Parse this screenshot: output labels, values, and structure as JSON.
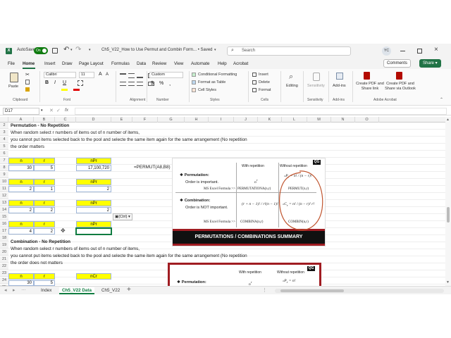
{
  "titlebar": {
    "autosave_label": "AutoSave",
    "autosave_state": "On",
    "file_name": "Ch5_V22_How to Use Permut and Combin Form... • Saved",
    "search_placeholder": "Search",
    "user_initials": "YC"
  },
  "menu": {
    "tabs": [
      "File",
      "Home",
      "Insert",
      "Draw",
      "Page Layout",
      "Formulas",
      "Data",
      "Review",
      "View",
      "Automate",
      "Help",
      "Acrobat"
    ],
    "active": "Home",
    "comments_label": "Comments",
    "share_label": "Share"
  },
  "ribbon": {
    "clipboard": {
      "paste_label": "Paste",
      "group_label": "Clipboard"
    },
    "font": {
      "family": "Calibri",
      "size": "11",
      "group_label": "Font"
    },
    "alignment": {
      "group_label": "Alignment"
    },
    "number": {
      "format": "Custom",
      "group_label": "Number"
    },
    "styles": {
      "conditional_formatting": "Conditional Formatting",
      "format_as_table": "Format as Table",
      "cell_styles": "Cell Styles",
      "group_label": "Styles"
    },
    "cells": {
      "insert": "Insert",
      "delete": "Delete",
      "format": "Format",
      "group_label": "Cells"
    },
    "editing": {
      "label": "Editing"
    },
    "sensitivity": {
      "label": "Sensitivity",
      "group_label": "Sensitivity"
    },
    "addins": {
      "label": "Add-ins",
      "group_label": "Add-ins"
    },
    "acrobat": {
      "create_pdf_link": "Create PDF and Share link",
      "create_pdf_outlook": "Create PDF and Share via Outlook",
      "group_label": "Adobe Acrobat"
    }
  },
  "formula_bar": {
    "name_box": "D17",
    "fx": "fx",
    "formula": ""
  },
  "grid": {
    "columns": [
      "A",
      "B",
      "C",
      "D",
      "E",
      "F",
      "G",
      "H",
      "I",
      "J",
      "K",
      "L",
      "M",
      "N",
      "O"
    ],
    "rows": [
      "2",
      "3",
      "4",
      "5",
      "6",
      "7",
      "8",
      "9",
      "10",
      "11",
      "12",
      "13",
      "14",
      "15",
      "16",
      "17",
      "18",
      "19",
      "20",
      "21",
      "22",
      "23",
      "24",
      "25"
    ],
    "perm_heading": "Permutation - No Repetition",
    "perm_lines": [
      "When random select r numbers of items out of n number of items,",
      "you cannot put items selected back to the pool and selecte the same item again for the same arrangement (No repetition",
      "the order matters"
    ],
    "comb_heading": "Combination - No Repetition",
    "comb_lines": [
      "When random select r numbers of items out of n number of items,",
      "you cannot put items selected back to the pool and selecte the same item again for the same arrangement (No repetition",
      "the order does not matters"
    ],
    "hdr_n": "n",
    "hdr_r": "r",
    "hdr_npr": "nPr",
    "hdr_ncr": "nCr",
    "blocks": [
      {
        "n": "30",
        "r": "5",
        "result": "17,100,720"
      },
      {
        "n": "2",
        "r": "1",
        "result": "2"
      },
      {
        "n": "2",
        "r": "2",
        "result": "2"
      },
      {
        "n": "4",
        "r": "2",
        "result": ""
      }
    ],
    "comb_block": {
      "n": "30",
      "r": "5"
    },
    "formula_note": "=PERMUT(A8,B8)",
    "paste_options": "(Ctrl)"
  },
  "summary_image": {
    "logo": "QG",
    "col_with": "With repetition",
    "col_without": "Without repetition",
    "permutation_title": "Permutation:",
    "permutation_desc": "Order is important.",
    "combination_title": "Combination:",
    "combination_desc": "Order is NOT important.",
    "formula_label": "MS Excel Formula >>",
    "perm_with": "n^r",
    "perm_with_fn": "PERMUTATIONA(n,r)",
    "perm_without_fn": "PERMUT(n,r)",
    "comb_with_fn": "COMBINA(n,r)",
    "comb_without_fn": "COMBIN(n,r)",
    "banner": "PERMUTATIONS / COMBINATIONS SUMMARY"
  },
  "summary_image2": {
    "logo": "QG",
    "col_with": "With repetition",
    "col_without": "Without repetition",
    "permutation_title": "Permutation:",
    "perm_with": "n^r"
  },
  "sheets": {
    "tabs": [
      "Index",
      "Ch5_V22 Data",
      "Ch5_V22"
    ],
    "active": "Ch5_V22 Data"
  },
  "colors": {
    "excel_green": "#217346",
    "yellow": "#ffff00",
    "banner_red": "#a01c22",
    "circle": "#c0552f"
  }
}
